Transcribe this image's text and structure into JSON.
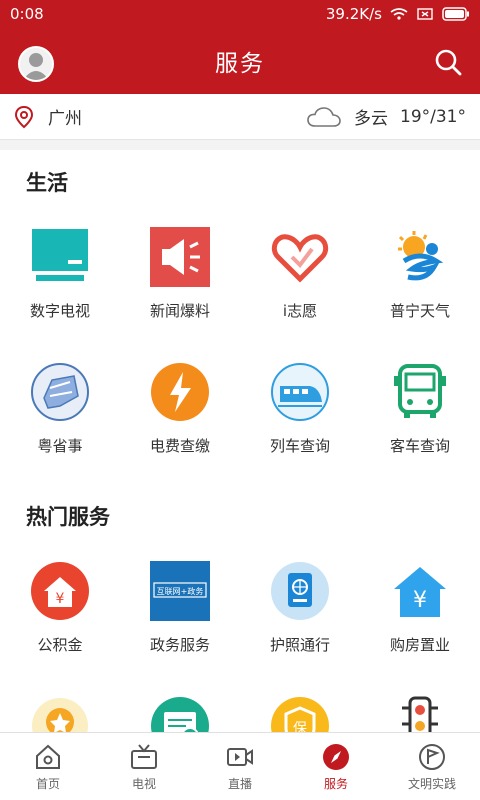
{
  "status": {
    "time": "0:08",
    "speed": "39.2K/s"
  },
  "header": {
    "title": "服务"
  },
  "weather": {
    "city": "广州",
    "condition": "多云",
    "temp": "19°/31°"
  },
  "sections": [
    {
      "title": "生活",
      "items": [
        {
          "label": "数字电视",
          "icon": "tv-icon"
        },
        {
          "label": "新闻爆料",
          "icon": "megaphone-icon"
        },
        {
          "label": "i志愿",
          "icon": "heart-hand-icon"
        },
        {
          "label": "普宁天气",
          "icon": "weather-icon"
        },
        {
          "label": "粤省事",
          "icon": "guangdong-icon"
        },
        {
          "label": "电费查缴",
          "icon": "lightning-icon"
        },
        {
          "label": "列车查询",
          "icon": "train-icon"
        },
        {
          "label": "客车查询",
          "icon": "bus-icon"
        }
      ]
    },
    {
      "title": "热门服务",
      "items": [
        {
          "label": "公积金",
          "icon": "housing-fund-icon"
        },
        {
          "label": "政务服务",
          "icon": "government-icon",
          "badge": "互联网+政务"
        },
        {
          "label": "护照通行",
          "icon": "passport-icon"
        },
        {
          "label": "购房置业",
          "icon": "house-yuan-icon"
        },
        {
          "label": "",
          "icon": "medal-icon"
        },
        {
          "label": "",
          "icon": "document-check-icon"
        },
        {
          "label": "",
          "icon": "insurance-icon",
          "badge": "保"
        },
        {
          "label": "",
          "icon": "traffic-light-icon"
        }
      ]
    }
  ],
  "tabs": [
    {
      "label": "首页",
      "icon": "home-icon"
    },
    {
      "label": "电视",
      "icon": "tv-tab-icon"
    },
    {
      "label": "直播",
      "icon": "live-icon"
    },
    {
      "label": "服务",
      "icon": "compass-icon",
      "active": true
    },
    {
      "label": "文明实践",
      "icon": "flag-icon"
    }
  ],
  "colors": {
    "brand": "#c0191f"
  }
}
